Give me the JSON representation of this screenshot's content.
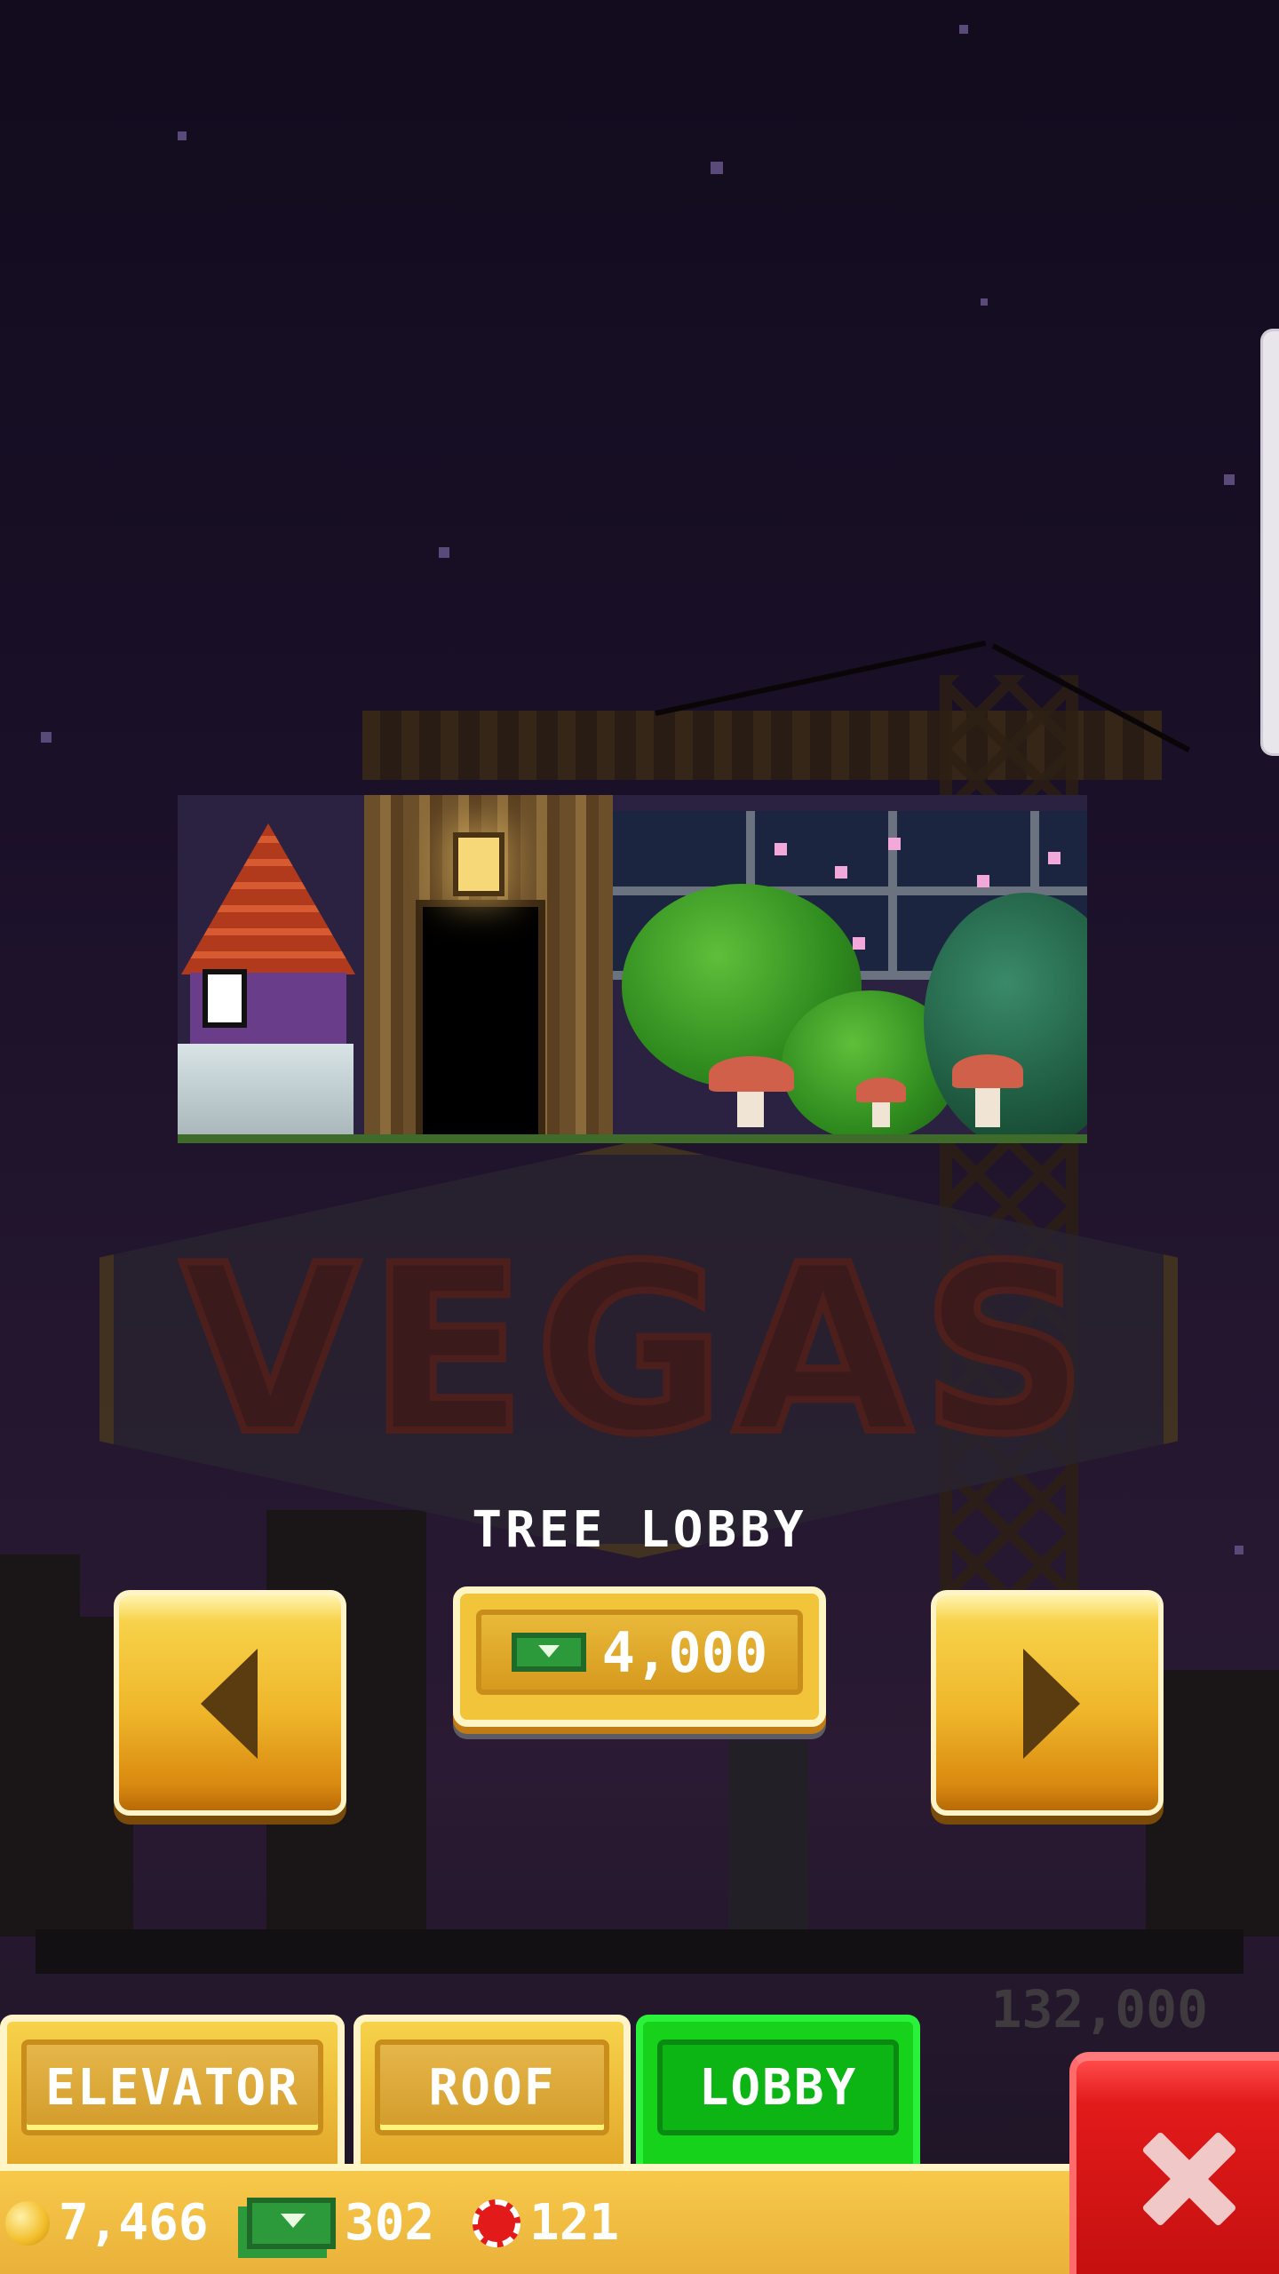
{
  "item": {
    "title": "TREE LOBBY",
    "price": "4,000",
    "price_icon": "bux-icon"
  },
  "navigation": {
    "prev_icon": "chevron-left-icon",
    "next_icon": "chevron-right-icon"
  },
  "background": {
    "floor_price": "132,000",
    "sign_text": "VEGAS"
  },
  "tabs": [
    {
      "label": "ELEVATOR",
      "active": false
    },
    {
      "label": "ROOF",
      "active": false
    },
    {
      "label": "LOBBY",
      "active": true
    }
  ],
  "currency": {
    "coins": "7,466",
    "bux": "302",
    "chips": "121"
  },
  "close_icon": "close-icon",
  "colors": {
    "active_tab": "#16d21a",
    "button_gold": "#f2c43a",
    "close_red": "#e21a1a"
  }
}
